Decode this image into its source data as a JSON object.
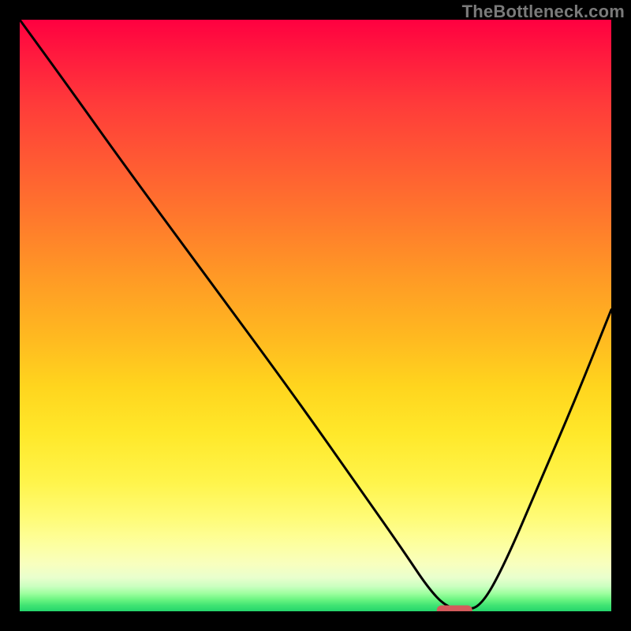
{
  "watermark": "TheBottleneck.com",
  "chart_data": {
    "type": "line",
    "title": "",
    "xlabel": "",
    "ylabel": "",
    "xlim": [
      0,
      100
    ],
    "ylim": [
      0,
      100
    ],
    "grid": false,
    "legend": false,
    "gradient": {
      "top_color": "#ff0040",
      "mid_color": "#ffd51e",
      "bottom_color": "#25d66c"
    },
    "series": [
      {
        "name": "bottleneck-curve",
        "color": "#000000",
        "x": [
          0,
          8,
          18,
          32,
          46,
          58,
          65,
          69,
          72,
          75,
          78,
          82,
          88,
          94,
          100
        ],
        "values": [
          100,
          89,
          75,
          56,
          37,
          20,
          10,
          4,
          0.8,
          0.2,
          0.8,
          8,
          22,
          36,
          51
        ]
      }
    ],
    "marker": {
      "shape": "rounded-rect",
      "color": "#d35b5c",
      "center_x": 73.5,
      "center_y": 0,
      "width": 6,
      "height": 2
    }
  }
}
